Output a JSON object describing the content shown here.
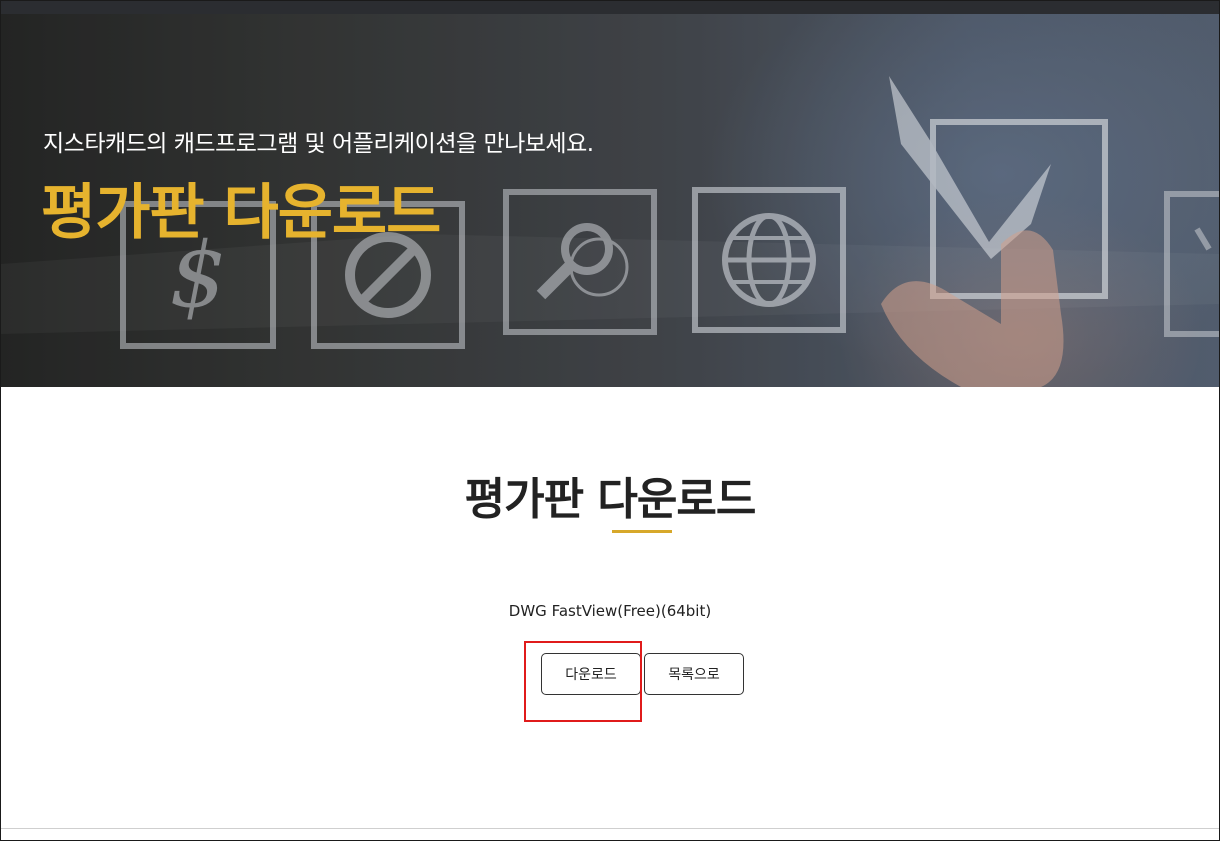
{
  "hero": {
    "subtitle": "지스타캐드의 캐드프로그램 및 어플리케이션을 만나보세요.",
    "title": "평가판 다운로드",
    "icons": [
      "dollar-icon",
      "prohibited-icon",
      "search-icon",
      "globe-icon",
      "checkmark-icon"
    ]
  },
  "main": {
    "title": "평가판 다운로드",
    "product_name": "DWG FastView(Free)(64bit)",
    "download_label": "다운로드",
    "list_label": "목록으로"
  },
  "colors": {
    "accent": "#e6b32e",
    "underline": "#d7a82a",
    "highlight": "#e01b1b"
  }
}
